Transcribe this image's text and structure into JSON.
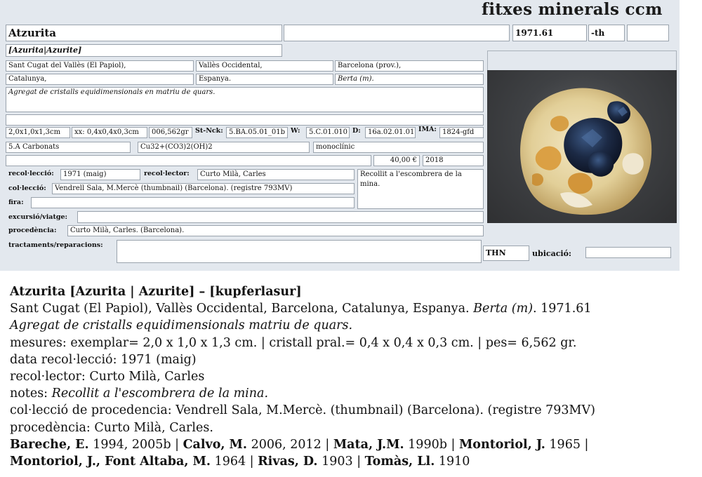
{
  "header": {
    "app_title": "fitxes minerals ccm"
  },
  "card": {
    "name": "Atzurita",
    "field_blank_1": "",
    "catalog_number": "1971.61",
    "suffix": "-th",
    "field_blank_2": "",
    "synonyms": "[Azurita|Azurite]",
    "locality": "Sant Cugat del Vallès (El Papiol),",
    "comarca": "Vallès Occidental,",
    "province": "Barcelona (prov.),",
    "region": "Catalunya,",
    "country": "Espanya.",
    "mine": "Berta (m).",
    "description": "Agregat de cristalls equidimensionals en matriu de quars.",
    "notes_line": "",
    "dims_specimen": "2,0x1,0x1,3cm",
    "dims_crystal": "xx: 0,4x0,4x0,3cm",
    "weight": "006,562gr",
    "stnck_label": "St-Nck:",
    "stnck_value": "5.BA.05.01_01b",
    "w_label": "W:",
    "w_value": "5.C.01.010",
    "d_label": "D:",
    "d_value": "16a.02.01.01",
    "ima_label": "IMA:",
    "ima_value": "1824-gfd",
    "class": "5.A Carbonats",
    "formula": "Cu32+(CO3)2(OH)2",
    "system": "monoclínic",
    "blank_row": "",
    "price": "40,00 €",
    "year": "2018",
    "collection_date_label": "recol·lecció:",
    "collection_date": "1971 (maig)",
    "collector_label": "recol·lector:",
    "collector": "Curto Milà, Carles",
    "remarks": "Recollit a l'escombrera de la mina.",
    "collection_label": "col·lecció:",
    "collection": "Vendrell Sala, M.Mercè (thumbnail) (Barcelona). (registre 793MV)",
    "fair_label": "fira:",
    "fair": "",
    "trip_label": "excursió/viatge:",
    "trip": "",
    "provenance_label": "procedència:",
    "provenance": "Curto Milà, Carles. (Barcelona).",
    "treatments_label": "tractaments/reparacions:",
    "treatments": "",
    "thn": "THN",
    "location_label": "ubicació:",
    "location": ""
  },
  "summary": {
    "title_name": "Atzurita [Azurita | Azurite] – [kupferlasur]",
    "place_a": "Sant Cugat (El Papiol), Vallès Occidental, Barcelona, Catalunya, Espanya.",
    "place_mine": "Berta (m)",
    "place_b": ". 1971.61",
    "description": "Agregat de cristalls equidimensionals matriu de quars.",
    "measures": "mesures: exemplar= 2,0 x 1,0 x 1,3 cm. | cristall pral.= 0,4 x 0,4 x 0,3 cm. | pes= 6,562 gr.",
    "date": "data recol·lecció:  1971 (maig)",
    "collector": "recol·lector: Curto Milà, Carles",
    "notes_prefix": "notes: ",
    "notes": "Recollit a l'escombrera de la mina.",
    "collection": "col·lecció de procedencia: Vendrell Sala, M.Mercè. (thumbnail) (Barcelona). (registre 793MV)",
    "provenance": "procedència: Curto Milà, Carles.",
    "refs": [
      {
        "author": "Bareche, E.",
        "years": " 1994, 2005b | "
      },
      {
        "author": "Calvo, M.",
        "years": " 2006, 2012 | "
      },
      {
        "author": "Mata, J.M.",
        "years": " 1990b | "
      },
      {
        "author": "Montoriol, J.",
        "years": " 1965 |"
      },
      {
        "author": "Montoriol, J., Font Altaba, M.",
        "years": " 1964 | "
      },
      {
        "author": "Rivas, D.",
        "years": " 1903 | "
      },
      {
        "author": "Tomàs, Ll.",
        "years": " 1910"
      }
    ]
  },
  "colors": {
    "panel_bg": "#e3e8ee",
    "field_border": "#9aa3ad",
    "matrix": "#e8d9a8",
    "crystal": "#1c2a45"
  }
}
